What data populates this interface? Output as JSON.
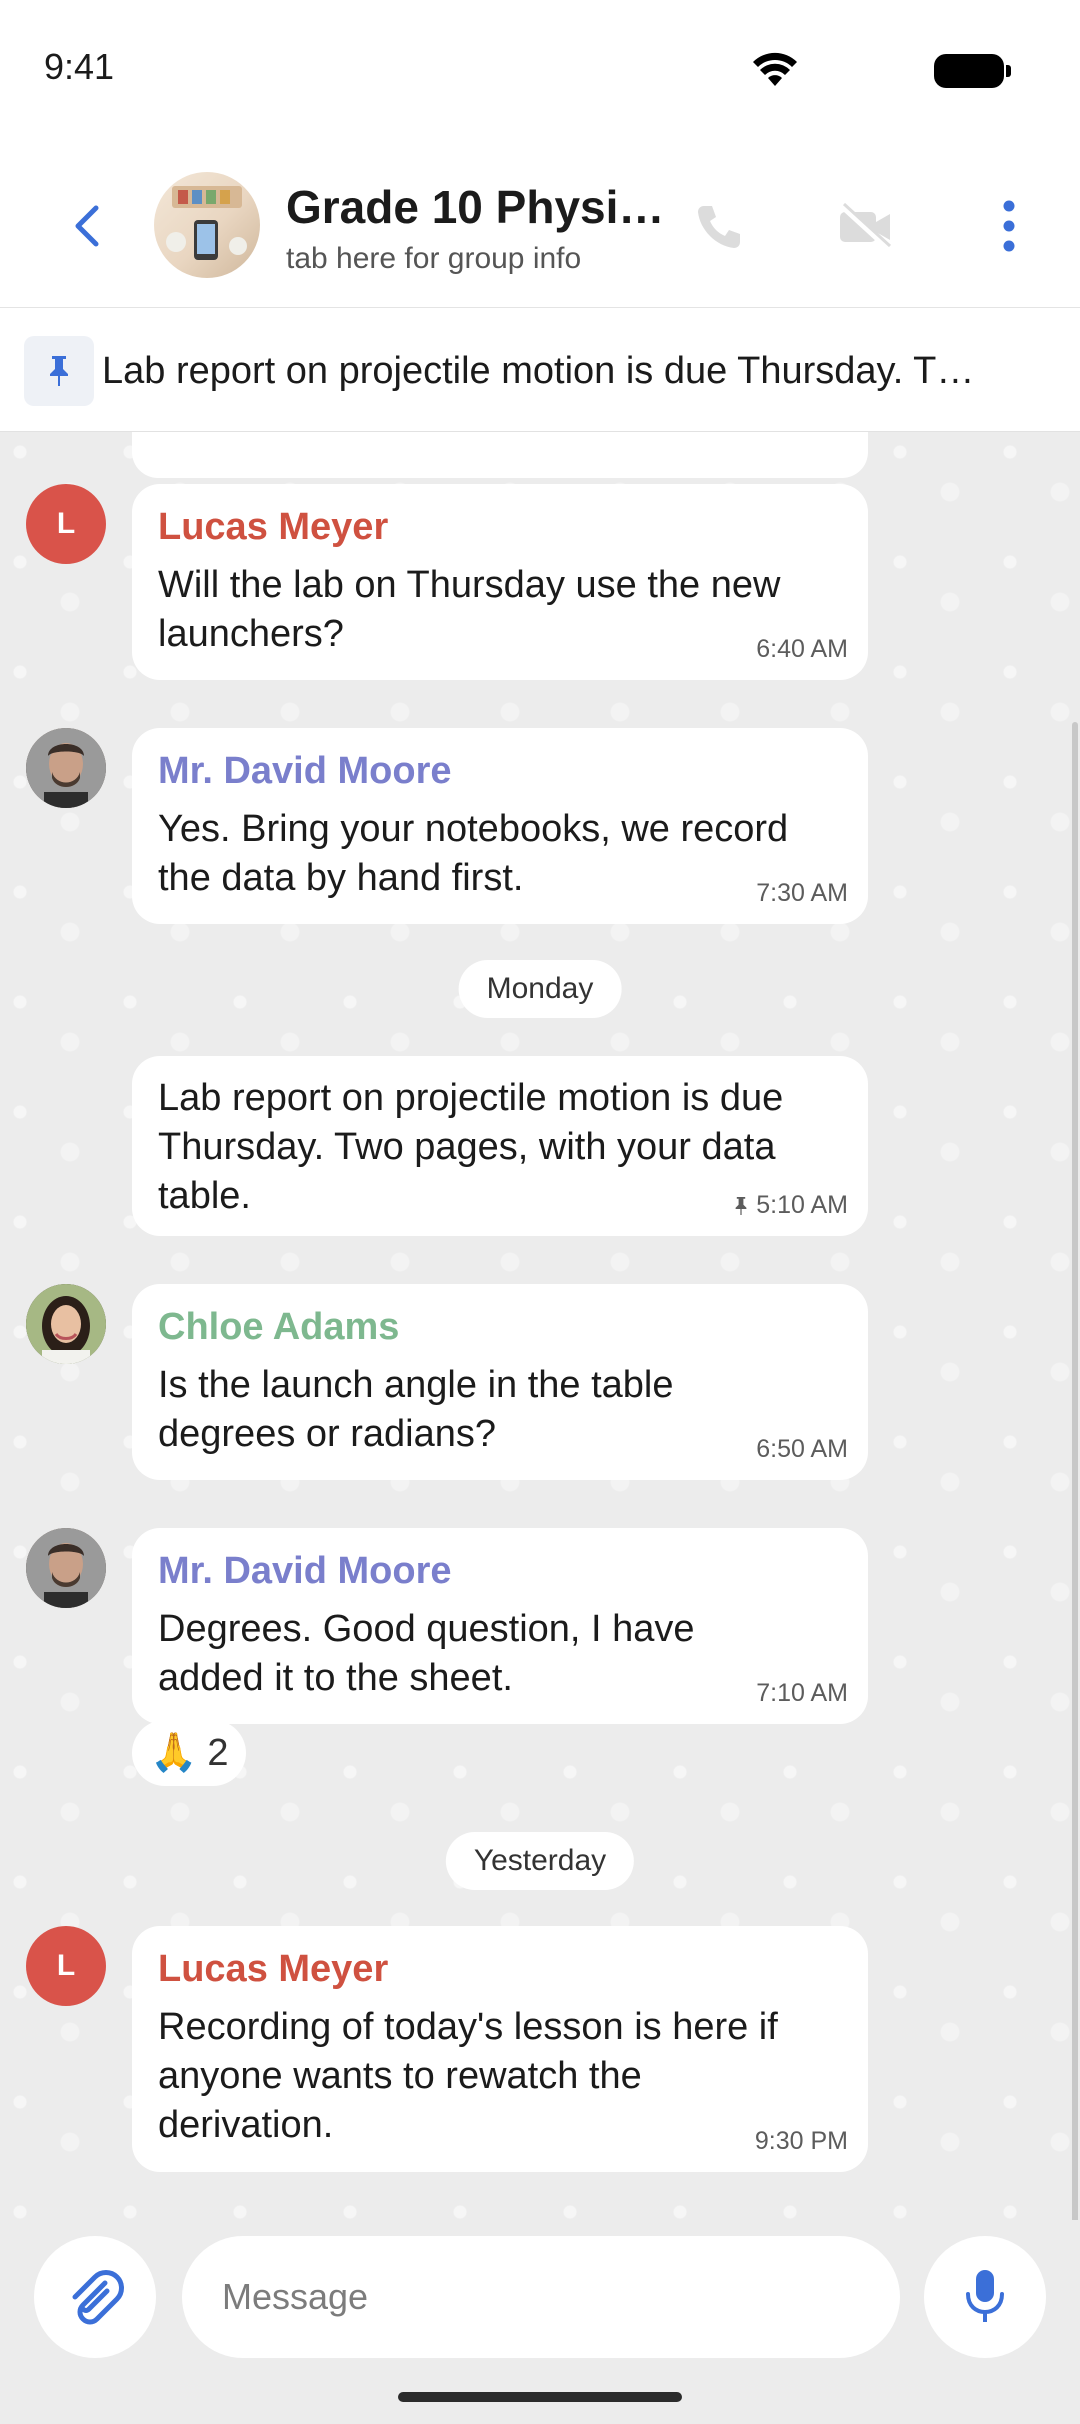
{
  "status_bar": {
    "time": "9:41"
  },
  "header": {
    "title": "Grade 10 Physi…",
    "subtitle": "tab here for group info"
  },
  "pinned": {
    "text": "Lab report on projectile motion is due Thursday. T…"
  },
  "messages": [
    {
      "sender": "Lucas Meyer",
      "avatar_letter": "L",
      "text": "Will the lab on Thursday use the new launchers?",
      "time": "6:40 AM"
    },
    {
      "sender": "Mr. David Moore",
      "text": "Yes. Bring your notebooks, we record the data by hand first.",
      "time": "7:30 AM"
    },
    {
      "date_separator": "Monday"
    },
    {
      "text": "Lab report on projectile motion is due Thursday. Two pages, with your data table.",
      "time": "5:10 AM",
      "pinned": true
    },
    {
      "sender": "Chloe Adams",
      "text": "Is the launch angle in the table degrees or radians?",
      "time": "6:50 AM"
    },
    {
      "sender": "Mr. David Moore",
      "text": "Degrees. Good question, I have added it to the sheet.",
      "time": "7:10 AM",
      "reaction": {
        "emoji": "🙏",
        "count": "2"
      }
    },
    {
      "date_separator": "Yesterday"
    },
    {
      "sender": "Lucas Meyer",
      "avatar_letter": "L",
      "text": "Recording of today's lesson is here if anyone wants to rewatch the derivation.",
      "time": "9:30 PM"
    }
  ],
  "composer": {
    "placeholder": "Message"
  },
  "colors": {
    "accent": "#3b6fd8",
    "lucas": "#cf5140",
    "david": "#7a7fcc",
    "chloe": "#7eb88f"
  }
}
